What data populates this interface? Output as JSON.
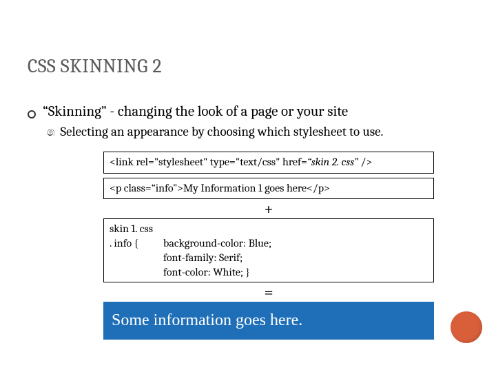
{
  "title": "CSS SKINNING 2",
  "bullet1": "“Skinning” - changing the look of a page or your site",
  "sub1": "Selecting an appearance by choosing which stylesheet to use.",
  "code_link_prefix": "<link rel=\"stylesheet\" type=\"text/css\" href=",
  "code_link_href": "“skin 2. css”",
  "code_link_suffix": " />",
  "code_p": "<p class=“info”>My Information 1 goes here</p>",
  "plus": "+",
  "css_file": "skin 1. css",
  "css_selector": ". info {",
  "css_rule1": "background-color: Blue;",
  "css_rule2": "font-family: Serif;",
  "css_rule3": "font-color: White; }",
  "equals": "=",
  "result": "Some information goes here."
}
